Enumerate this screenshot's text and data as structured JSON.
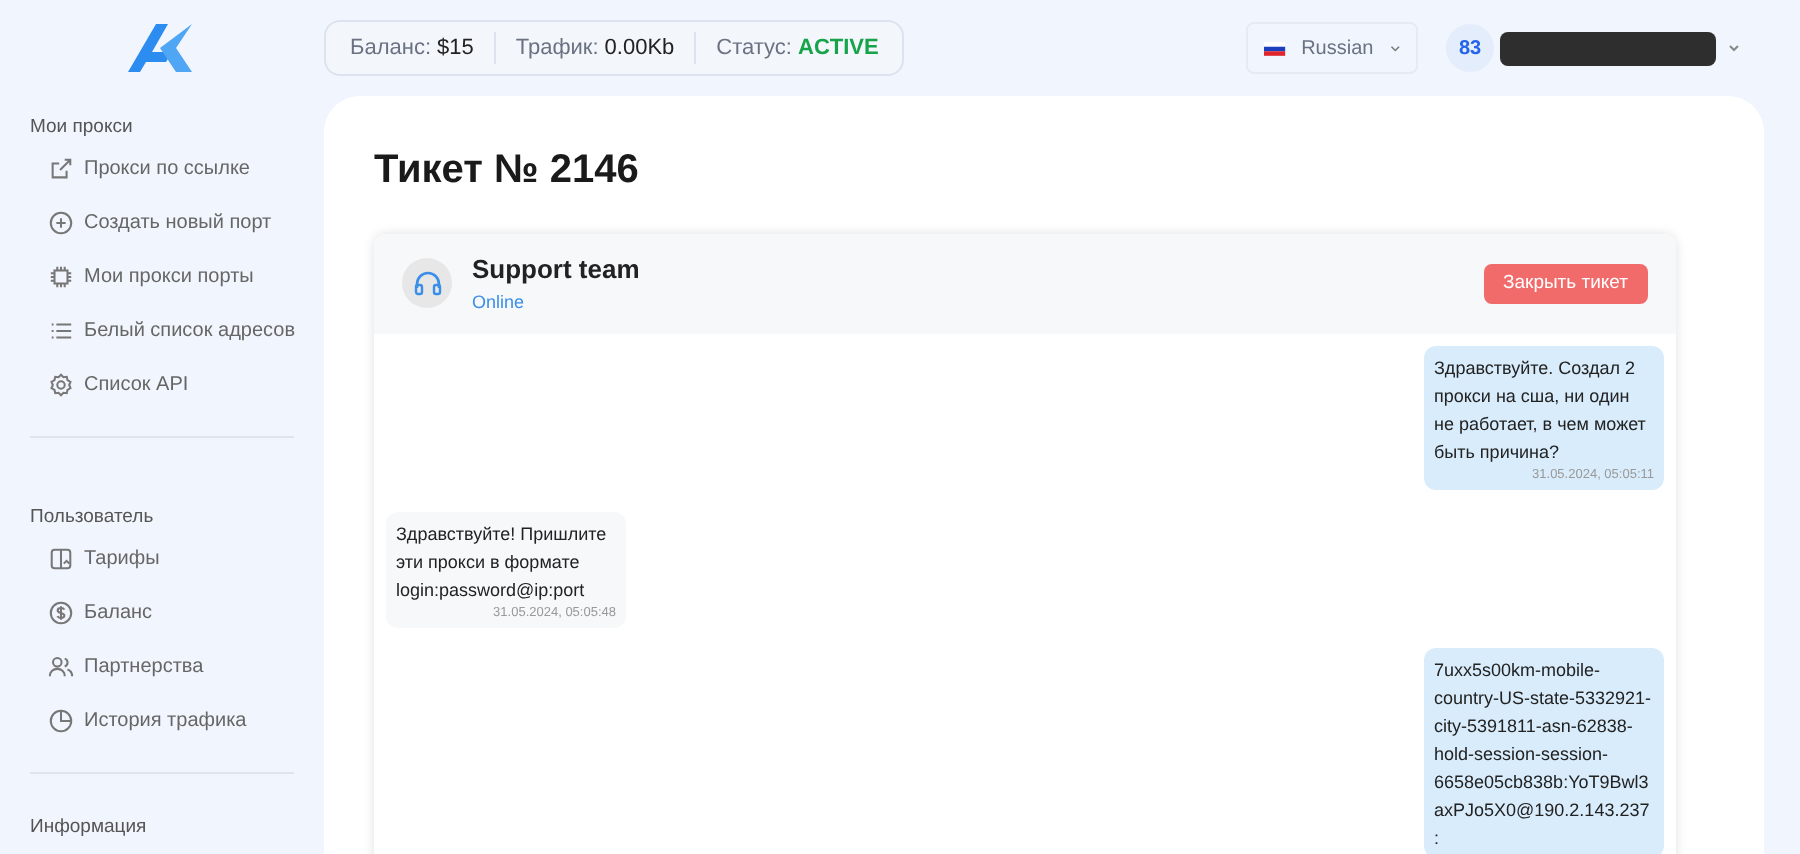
{
  "topbar": {
    "stats": [
      {
        "label": "Баланс:",
        "value": "$15",
        "kind": "plain"
      },
      {
        "label": "Трафик:",
        "value": "0.00Kb",
        "kind": "plain"
      },
      {
        "label": "Статус:",
        "value": "ACTIVE",
        "kind": "status"
      }
    ],
    "language": "Russian",
    "user_badge": "83"
  },
  "sidebar": {
    "sections": [
      {
        "title": "Мои прокси",
        "items": [
          {
            "label": "Прокси по ссылке"
          },
          {
            "label": "Создать новый порт"
          },
          {
            "label": "Мои прокси порты"
          },
          {
            "label": "Белый список адресов"
          },
          {
            "label": "Список API"
          }
        ]
      },
      {
        "title": "Пользователь",
        "items": [
          {
            "label": "Тарифы"
          },
          {
            "label": "Баланс"
          },
          {
            "label": "Партнерства"
          },
          {
            "label": "История трафика"
          }
        ]
      },
      {
        "title": "Информация"
      }
    ]
  },
  "page": {
    "title": "Тикет № 2146"
  },
  "chat": {
    "name": "Support team",
    "status": "Online",
    "close_button": "Закрыть тикет",
    "messages": [
      {
        "kind": "outgoing",
        "text": "Здравствуйте. Создал 2 прокси на сша, ни один не работает, в чем может быть причина?",
        "time": "31.05.2024, 05:05:11"
      },
      {
        "kind": "incoming",
        "text": "Здравствуйте! Пришлите эти прокси в формате login:password@ip:port",
        "time": "31.05.2024, 05:05:48"
      },
      {
        "kind": "outgoing",
        "text": "7uxx5s00km-mobile-country-US-state-5332921-city-5391811-asn-62838-hold-session-session-6658e05cb838b:YoT9Bwl3axPJo5X0@190.2.143.237:"
      }
    ]
  }
}
